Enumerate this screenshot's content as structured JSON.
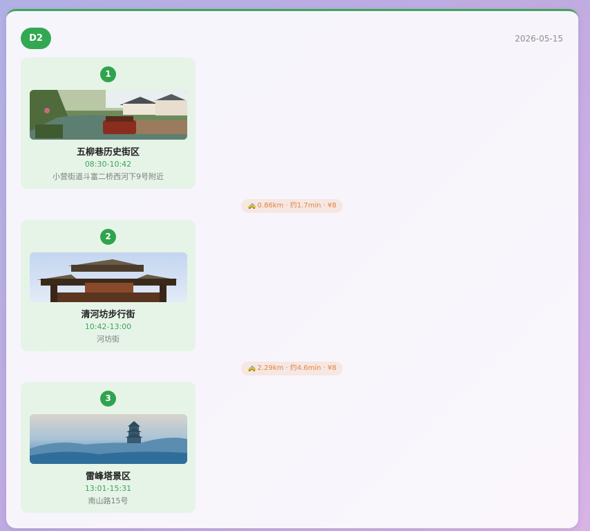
{
  "day": {
    "label": "D2",
    "date": "2026-05-15"
  },
  "stops": [
    {
      "number": "1",
      "name": "五柳巷历史街区",
      "time": "08:30-10:42",
      "address": "小营街道斗富二桥西河下9号附近"
    },
    {
      "number": "2",
      "name": "清河坊步行街",
      "time": "10:42-13:00",
      "address": "河坊街"
    },
    {
      "number": "3",
      "name": "雷峰塔景区",
      "time": "13:01-15:31",
      "address": "南山路15号"
    }
  ],
  "transits": [
    {
      "icon": "car-icon",
      "text": "0.86km · 约1.7min · ¥8"
    },
    {
      "icon": "car-icon",
      "text": "2.29km · 约4.6min · ¥8"
    }
  ],
  "colors": {
    "accent": "#33a852",
    "card_bg": "#e6f4e8",
    "transit_text": "#e08440",
    "transit_bg": "#f6e7e2"
  }
}
